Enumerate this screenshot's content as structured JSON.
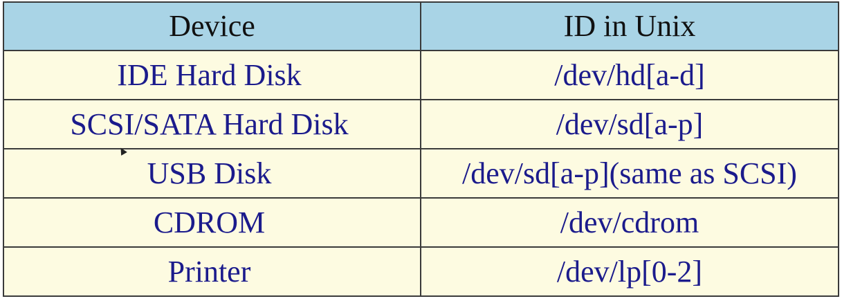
{
  "table": {
    "headers": [
      "Device",
      "ID in Unix"
    ],
    "rows": [
      {
        "device": "IDE Hard Disk",
        "id": "/dev/hd[a-d]"
      },
      {
        "device": "SCSI/SATA Hard Disk",
        "id": "/dev/sd[a-p]"
      },
      {
        "device": "USB Disk",
        "id": "/dev/sd[a-p](same as SCSI)"
      },
      {
        "device": "CDROM",
        "id": "/dev/cdrom"
      },
      {
        "device": "Printer",
        "id": "/dev/lp[0-2]"
      }
    ]
  },
  "colors": {
    "header_background": "#a9d4e6",
    "row_background": "#fdfbe1",
    "header_text": "#111111",
    "row_text": "#1b1b8c",
    "border": "#3a3a3a"
  },
  "icons": {
    "cursor": "mouse-pointer-icon"
  }
}
